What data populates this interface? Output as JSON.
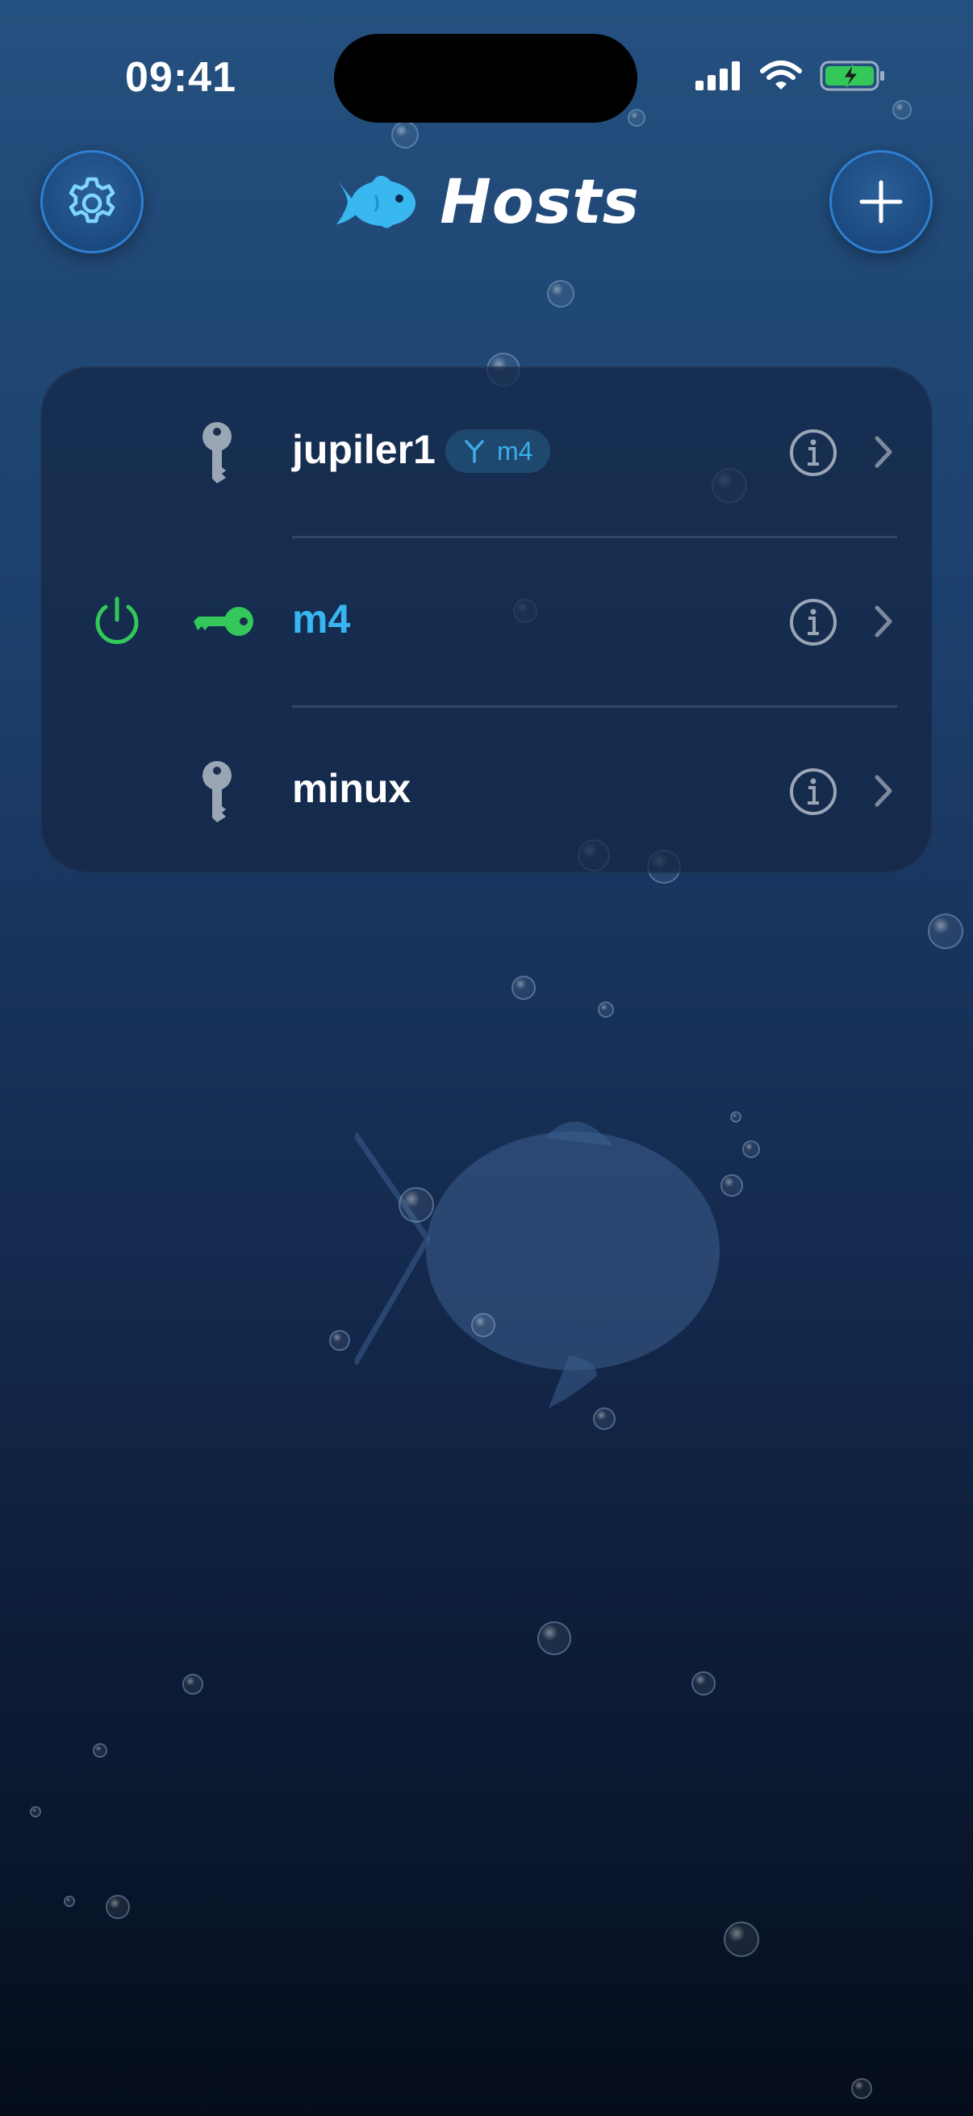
{
  "status_bar": {
    "time": "09:41"
  },
  "header": {
    "title": "Hosts",
    "settings_icon": "gear-icon",
    "add_icon": "plus-icon",
    "logo_icon": "fish-icon"
  },
  "hosts": [
    {
      "name": "jupiler1",
      "icon": "key-icon",
      "jump_host": "m4",
      "jump_icon": "branch-icon",
      "connected": false
    },
    {
      "name": "m4",
      "icon": "key-icon",
      "connected": true,
      "status_icon": "power-icon"
    },
    {
      "name": "minux",
      "icon": "key-icon",
      "connected": false
    }
  ],
  "colors": {
    "accent": "#38b6f2",
    "connected": "#34c759",
    "key_inactive": "#9aa6b6"
  }
}
